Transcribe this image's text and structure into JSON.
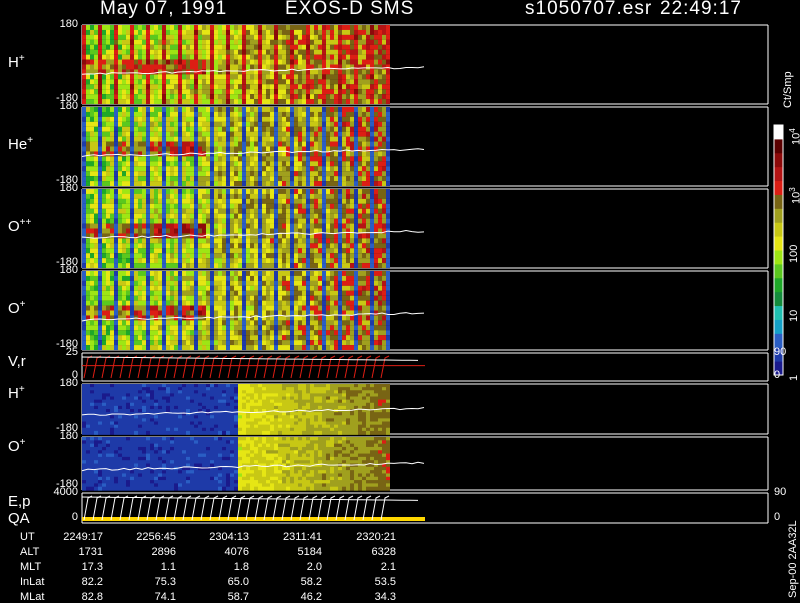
{
  "header": {
    "date": "May 07, 1991",
    "instrument": "EXOS-D SMS",
    "file": "s1050707.esr",
    "time": "22:49:17"
  },
  "colorbar": {
    "unit": "Ct/Smp",
    "ticks": [
      {
        "label": "1",
        "value": 1
      },
      {
        "label": "10",
        "value": 10
      },
      {
        "label": "100",
        "value": 100
      },
      {
        "label": "10",
        "sup": "3",
        "value": 1000
      },
      {
        "label": "10",
        "sup": "4",
        "value": 10000
      }
    ],
    "colors": [
      "#1a1a8c",
      "#1e3aa8",
      "#2a5ec4",
      "#14a0c8",
      "#20c0b0",
      "#148c3c",
      "#1ea828",
      "#5ac81e",
      "#9ee614",
      "#e6e614",
      "#c8c814",
      "#a0a01e",
      "#786414",
      "#dc1e14",
      "#b41414",
      "#8c0a0a",
      "#5a0000",
      "#ffffff"
    ]
  },
  "chart_data": [
    {
      "type": "heatmap",
      "panel": "H+",
      "label": "H",
      "sup": "+",
      "ylim": [
        -180,
        180
      ],
      "yticks": [
        "180",
        "-180"
      ],
      "style": "stripes-red"
    },
    {
      "type": "heatmap",
      "panel": "He+",
      "label": "He",
      "sup": "+",
      "ylim": [
        -180,
        180
      ],
      "yticks": [
        "180",
        "-180"
      ],
      "style": "stripes-blue"
    },
    {
      "type": "heatmap",
      "panel": "O++",
      "label": "O",
      "sup": "++",
      "ylim": [
        -180,
        180
      ],
      "yticks": [
        "180",
        "-180"
      ],
      "style": "stripes-blue"
    },
    {
      "type": "heatmap",
      "panel": "O+",
      "label": "O",
      "sup": "+",
      "ylim": [
        -180,
        180
      ],
      "yticks": [
        "180",
        "-180"
      ],
      "style": "stripes-mixed"
    },
    {
      "type": "line",
      "panel": "V,r",
      "label": "V,r",
      "ylim": [
        0,
        25
      ],
      "yticks": [
        "25",
        "0"
      ],
      "right_ticks": [
        "90",
        "0"
      ]
    },
    {
      "type": "heatmap",
      "panel": "H+ (2)",
      "label": "H",
      "sup": "+",
      "ylim": [
        -180,
        180
      ],
      "yticks": [
        "180",
        "-180"
      ],
      "style": "blocks"
    },
    {
      "type": "heatmap",
      "panel": "O+ (2)",
      "label": "O",
      "sup": "+",
      "ylim": [
        -180,
        180
      ],
      "yticks": [
        "180",
        "-180"
      ],
      "style": "blocks"
    },
    {
      "type": "line",
      "panel": "E,p QA",
      "label": "E,p",
      "label2": "QA",
      "ylim": [
        0,
        4000
      ],
      "yticks": [
        "4000",
        "0"
      ],
      "right_ticks": [
        "90",
        "0"
      ]
    }
  ],
  "footer": {
    "rows": [
      {
        "name": "UT",
        "values": [
          "2249:17",
          "2256:45",
          "2304:13",
          "2311:41",
          "2320:21"
        ]
      },
      {
        "name": "ALT",
        "values": [
          "1731",
          "2896",
          "4076",
          "5184",
          "6328"
        ]
      },
      {
        "name": "MLT",
        "values": [
          "17.3",
          "1.1",
          "1.8",
          "2.0",
          "2.1"
        ]
      },
      {
        "name": "InLat",
        "values": [
          "82.2",
          "75.3",
          "65.0",
          "58.2",
          "53.5"
        ]
      },
      {
        "name": "MLat",
        "values": [
          "82.8",
          "74.1",
          "58.7",
          "46.2",
          "34.3"
        ]
      }
    ],
    "stamp": "Sep-00 2AA32L"
  }
}
